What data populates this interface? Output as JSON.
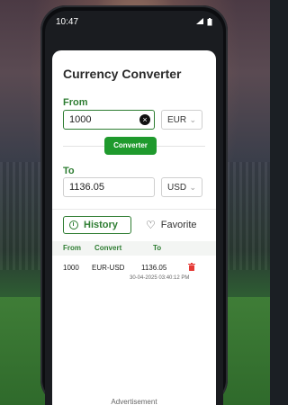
{
  "status_bar": {
    "time": "10:47"
  },
  "app": {
    "title": "Currency Converter",
    "from_label": "From",
    "to_label": "To",
    "from_amount": "1000",
    "from_currency": "EUR",
    "convert_button": "Converter",
    "to_amount": "1136.05",
    "to_currency": "USD",
    "tabs": {
      "history": "History",
      "favorite": "Favorite"
    },
    "history_table": {
      "headers": [
        "From",
        "Convert",
        "To"
      ],
      "rows": [
        {
          "from": "1000",
          "convert": "EUR-USD",
          "to": "1136.05",
          "date": "30-04-2025 03:40:12 PM"
        }
      ]
    },
    "advertisement": "Advertisement"
  },
  "colors": {
    "accent": "#2e7d32",
    "button": "#1f9a2d",
    "delete": "#e53935"
  }
}
